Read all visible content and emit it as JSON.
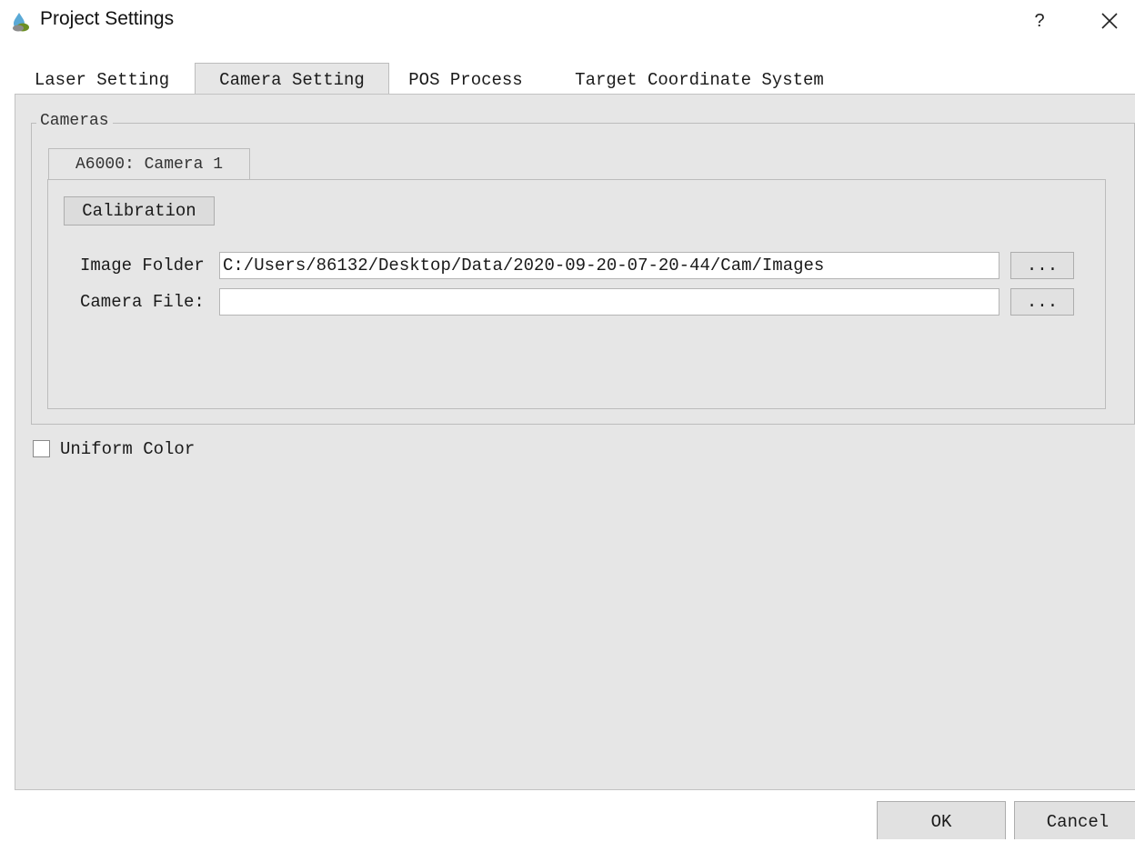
{
  "window": {
    "title": "Project Settings",
    "help_label": "?"
  },
  "tabs": [
    {
      "label": "Laser Setting",
      "active": false
    },
    {
      "label": "Camera Setting",
      "active": true
    },
    {
      "label": "POS Process",
      "active": false
    },
    {
      "label": "Target Coordinate System",
      "active": false
    }
  ],
  "cameras": {
    "group_title": "Cameras",
    "camera_tab": "A6000: Camera 1",
    "calibration_label": "Calibration",
    "image_folder": {
      "label": "Image Folder",
      "value": "C:/Users/86132/Desktop/Data/2020-09-20-07-20-44/Cam/Images",
      "browse_label": "..."
    },
    "camera_file": {
      "label": "Camera File:",
      "value": "",
      "browse_label": "..."
    }
  },
  "uniform_color": {
    "label": "Uniform Color",
    "checked": false
  },
  "buttons": {
    "ok": "OK",
    "cancel": "Cancel"
  }
}
